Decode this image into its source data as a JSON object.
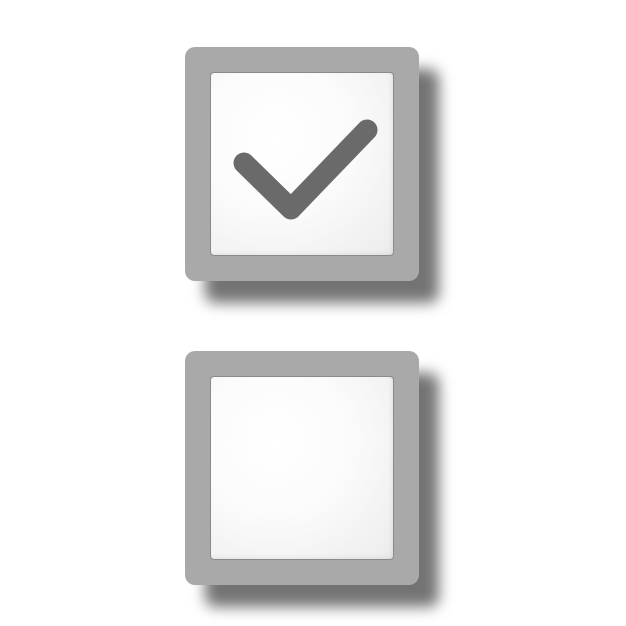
{
  "checkboxes": [
    {
      "id": "checked",
      "checked": true
    },
    {
      "id": "unchecked",
      "checked": false
    }
  ],
  "colors": {
    "frame": "#a9a9a9",
    "inner": "#ffffff",
    "check": "#6a6a6a",
    "background": "#ffffff"
  }
}
